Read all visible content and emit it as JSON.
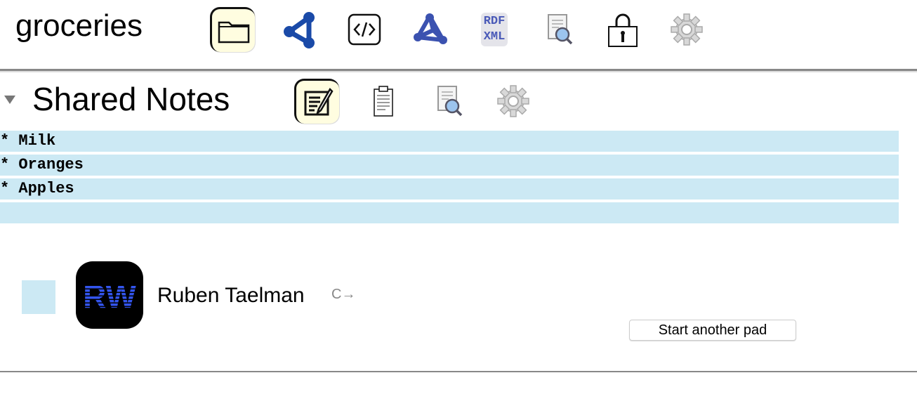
{
  "header": {
    "title": "groceries",
    "icons": [
      "folder-icon",
      "network-icon",
      "code-icon",
      "graph-icon",
      "rdf-xml-icon",
      "search-document-icon",
      "lock-icon",
      "gear-icon"
    ],
    "rdf_label_top": "RDF",
    "rdf_label_bottom": "XML"
  },
  "section": {
    "title": "Shared Notes",
    "icons": [
      "edit-icon",
      "clipboard-icon",
      "search-document-icon",
      "gear-icon"
    ]
  },
  "notes": {
    "lines": [
      "* Milk",
      "* Oranges",
      "* Apples",
      ""
    ],
    "highlight_color": "#cce9f4"
  },
  "user": {
    "name": "Ruben Taelman",
    "avatar_text": "RW",
    "avatar_color": "#3355ee",
    "logout_symbol": "C→"
  },
  "actions": {
    "start_another_pad": "Start another pad"
  }
}
